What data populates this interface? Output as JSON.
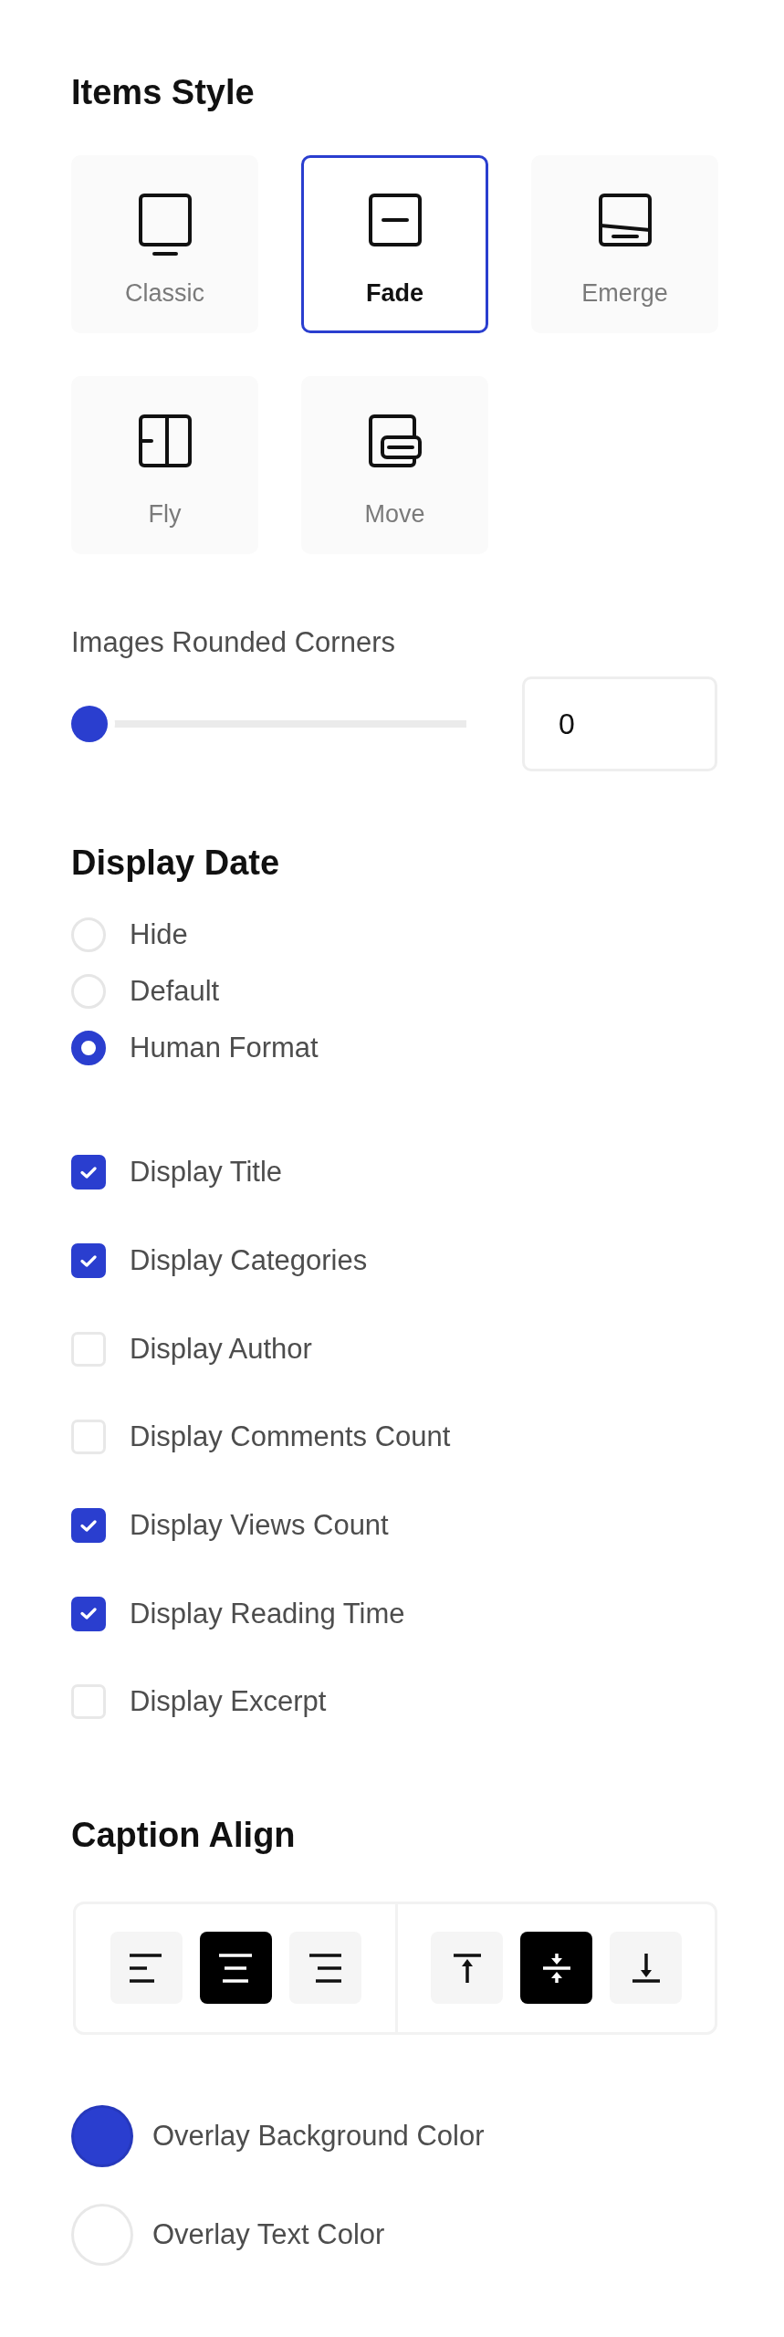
{
  "items_style": {
    "title": "Items Style",
    "options": [
      {
        "label": "Classic",
        "kind": "classic",
        "selected": false
      },
      {
        "label": "Fade",
        "kind": "fade",
        "selected": true
      },
      {
        "label": "Emerge",
        "kind": "emerge",
        "selected": false
      },
      {
        "label": "Fly",
        "kind": "fly",
        "selected": false
      },
      {
        "label": "Move",
        "kind": "move",
        "selected": false
      }
    ]
  },
  "rounded_corners": {
    "label": "Images Rounded Corners",
    "level": 0,
    "value": "0"
  },
  "display_date": {
    "title": "Display Date",
    "options": [
      {
        "label": "Hide",
        "selected": false
      },
      {
        "label": "Default",
        "selected": false
      },
      {
        "label": "Human Format",
        "selected": true
      }
    ]
  },
  "display_options": [
    {
      "label": "Display Title",
      "checked": true
    },
    {
      "label": "Display Categories",
      "checked": true
    },
    {
      "label": "Display Author",
      "checked": false
    },
    {
      "label": "Display Comments Count",
      "checked": false
    },
    {
      "label": "Display Views Count",
      "checked": true
    },
    {
      "label": "Display Reading Time",
      "checked": true
    },
    {
      "label": "Display Excerpt",
      "checked": false
    }
  ],
  "caption_align": {
    "title": "Caption Align",
    "horizontal": [
      {
        "kind": "left",
        "selected": false
      },
      {
        "kind": "center",
        "selected": true
      },
      {
        "kind": "right",
        "selected": false
      }
    ],
    "vertical": [
      {
        "kind": "top",
        "selected": false
      },
      {
        "kind": "middle",
        "selected": true
      },
      {
        "kind": "bottom",
        "selected": false
      }
    ]
  },
  "overlay_colors": [
    {
      "label": "Overlay Background Color",
      "color": "#2a3ecf"
    },
    {
      "label": "Overlay Text Color",
      "color": "#ffffff"
    }
  ]
}
